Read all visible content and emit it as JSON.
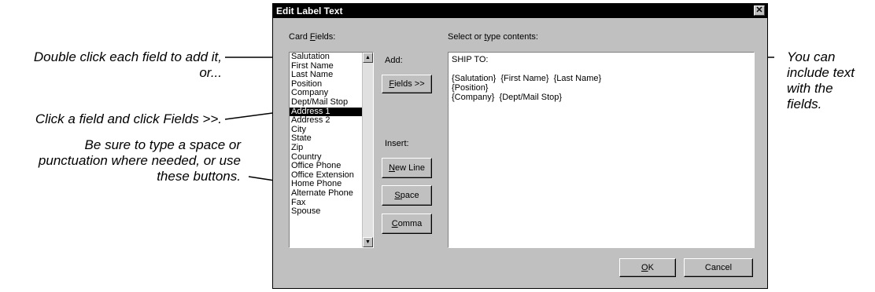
{
  "dialog": {
    "title": "Edit Label Text",
    "close_glyph": "✕",
    "card_fields_label_pre": "Card ",
    "card_fields_label_key": "F",
    "card_fields_label_post": "ields:",
    "contents_label_pre": "Select or ",
    "contents_label_key": "t",
    "contents_label_post": "ype contents:",
    "add_label": "Add:",
    "insert_label": "Insert:",
    "fields_button": {
      "key": "F",
      "rest": "ields >>"
    },
    "newline_button": {
      "key": "N",
      "rest": "ew Line"
    },
    "space_button": {
      "key": "S",
      "rest": "pace"
    },
    "comma_button": {
      "key": "C",
      "rest": "omma"
    },
    "ok_button": {
      "key": "O",
      "rest": "K"
    },
    "cancel_button": "Cancel",
    "fields": [
      "Salutation",
      "First Name",
      "Last Name",
      "Position",
      "Company",
      "Dept/Mail Stop",
      "Address 1",
      "Address 2",
      "City",
      "State",
      "Zip",
      "Country",
      "Office Phone",
      "Office Extension",
      "Home Phone",
      "Alternate Phone",
      "Fax",
      "Spouse"
    ],
    "selected_field": "Address 1",
    "contents_lines": [
      "SHIP TO:",
      "",
      "{Salutation}  {First Name}  {Last Name}",
      "{Position}",
      "{Company}  {Dept/Mail Stop}"
    ]
  },
  "annotations": {
    "double_click_1": "Double click each field to add it,",
    "double_click_2": "or...",
    "click_field": "Click a field and click Fields >>.",
    "be_sure_1": "Be sure to type a space or",
    "be_sure_2": "punctuation where needed, or use",
    "be_sure_3": "these buttons.",
    "include_1": "You can",
    "include_2": "include text",
    "include_3": "with the",
    "include_4": "fields."
  }
}
